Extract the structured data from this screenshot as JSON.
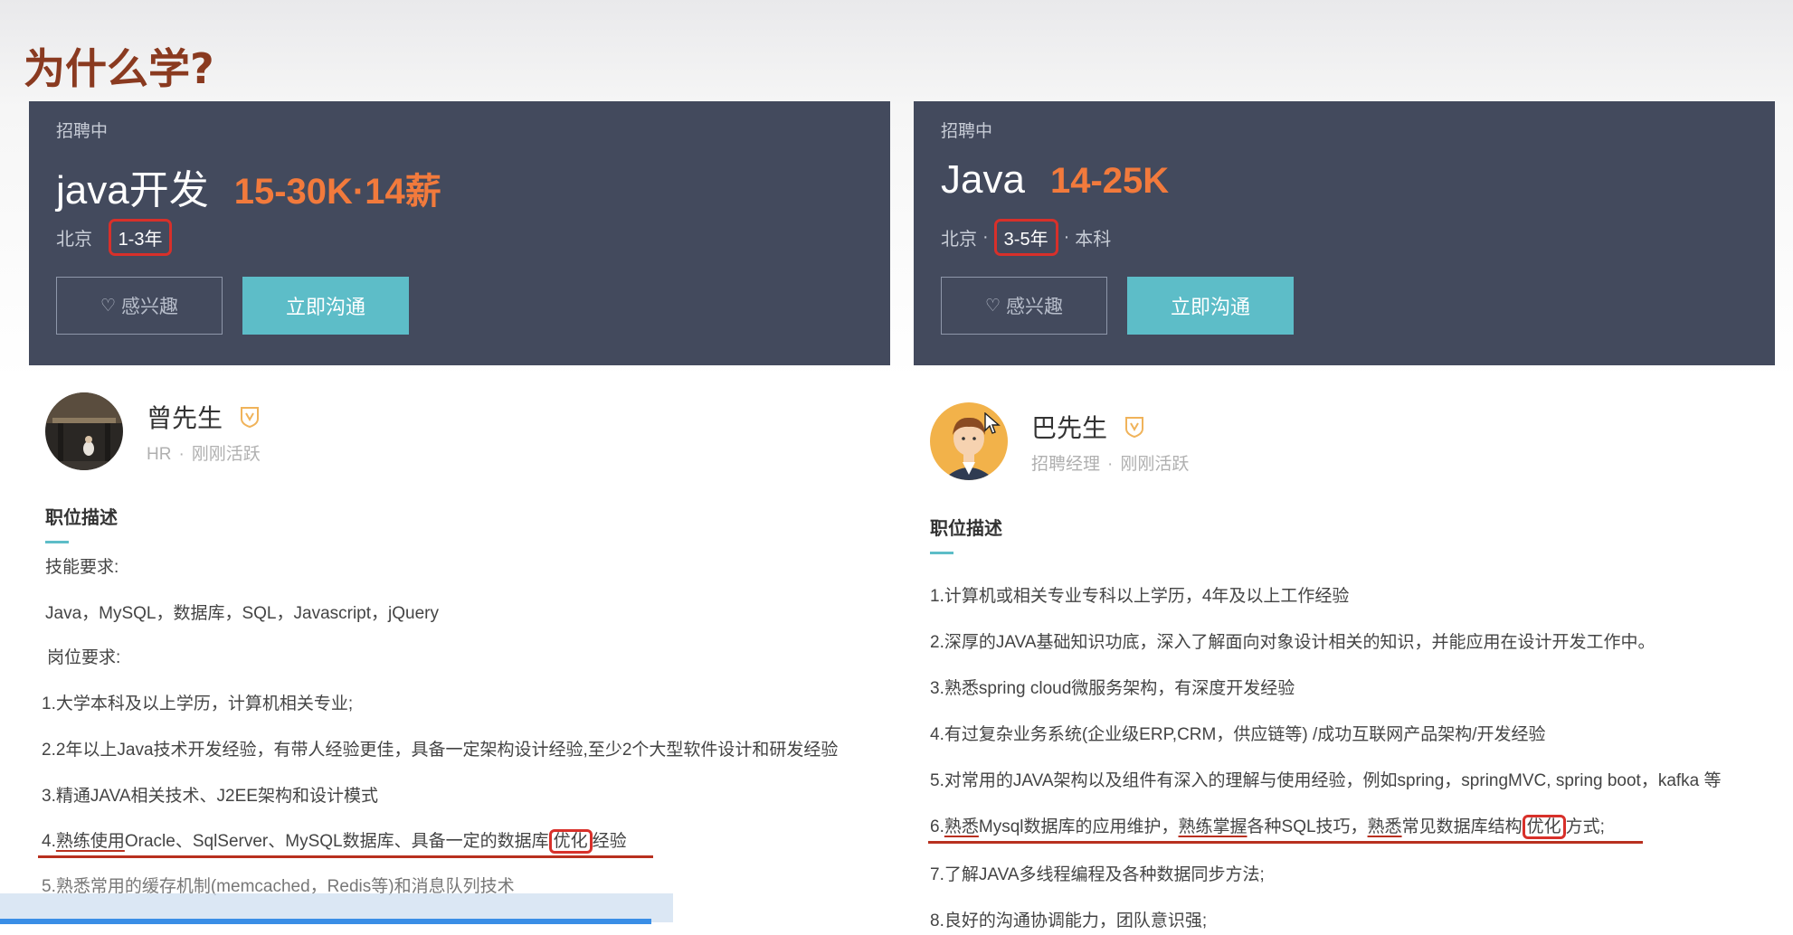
{
  "slide_title": "为什么学?",
  "left": {
    "status": "招聘中",
    "job_title": "java开发",
    "salary": "15-30K·14薪",
    "city": "北京",
    "experience": "1-3年",
    "interest_label": "感兴趣",
    "chat_label": "立即沟通",
    "recruiter_name": "曾先生",
    "recruiter_role": "HR",
    "recruiter_active": "刚刚活跃",
    "desc_heading": "职位描述",
    "lines": {
      "l1": "技能要求:",
      "l2": "Java，MySQL，数据库，SQL，Javascript，jQuery",
      "l3": "岗位要求:",
      "l4": "1.大学本科及以上学历，计算机相关专业;",
      "l5": "2.2年以上Java技术开发经验，有带人经验更佳，具备一定架构设计经验,至少2个大型软件设计和研发经验",
      "l6": "3.精通JAVA相关技术、J2EE架构和设计模式",
      "l7a": "4.",
      "l7b": "熟练使用",
      "l7c": "Oracle、SqlServer、MySQL数据库、具备一定的数据库",
      "l7d": "优化",
      "l7e": "经验",
      "l8": "5.熟悉常用的缓存机制(memcached，Redis等)和消息队列技术"
    }
  },
  "right": {
    "status": "招聘中",
    "job_title": "Java",
    "salary": "14-25K",
    "city": "北京",
    "experience": "3-5年",
    "education": "本科",
    "interest_label": "感兴趣",
    "chat_label": "立即沟通",
    "recruiter_name": "巴先生",
    "recruiter_role": "招聘经理",
    "recruiter_active": "刚刚活跃",
    "desc_heading": "职位描述",
    "lines": {
      "l1": "1.计算机或相关专业专科以上学历，4年及以上工作经验",
      "l2": "2.深厚的JAVA基础知识功底，深入了解面向对象设计相关的知识，并能应用在设计开发工作中。",
      "l3": "3.熟悉spring cloud微服务架构，有深度开发经验",
      "l4": "4.有过复杂业务系统(企业级ERP,CRM，供应链等) /成功互联网产品架构/开发经验",
      "l5": "5.对常用的JAVA架构以及组件有深入的理解与使用经验，例如spring，springMVC, spring boot，kafka 等",
      "l6a": "6.",
      "l6b": "熟悉",
      "l6c": "Mysql数据库的应用维护，",
      "l6d": "熟练掌握",
      "l6e": "各种SQL技巧，",
      "l6f": "熟悉",
      "l6g": "常见数据库结构",
      "l6h": "优化",
      "l6i": "方式;",
      "l7": "7.了解JAVA多线程编程及各种数据同步方法;",
      "l8": "8.良好的沟通协调能力，团队意识强;"
    }
  },
  "colors": {
    "banner": "#434a5d",
    "salary": "#f27a3c",
    "chat_button": "#5dbdc8",
    "highlight": "#d8302a",
    "title": "#8a3a20"
  }
}
